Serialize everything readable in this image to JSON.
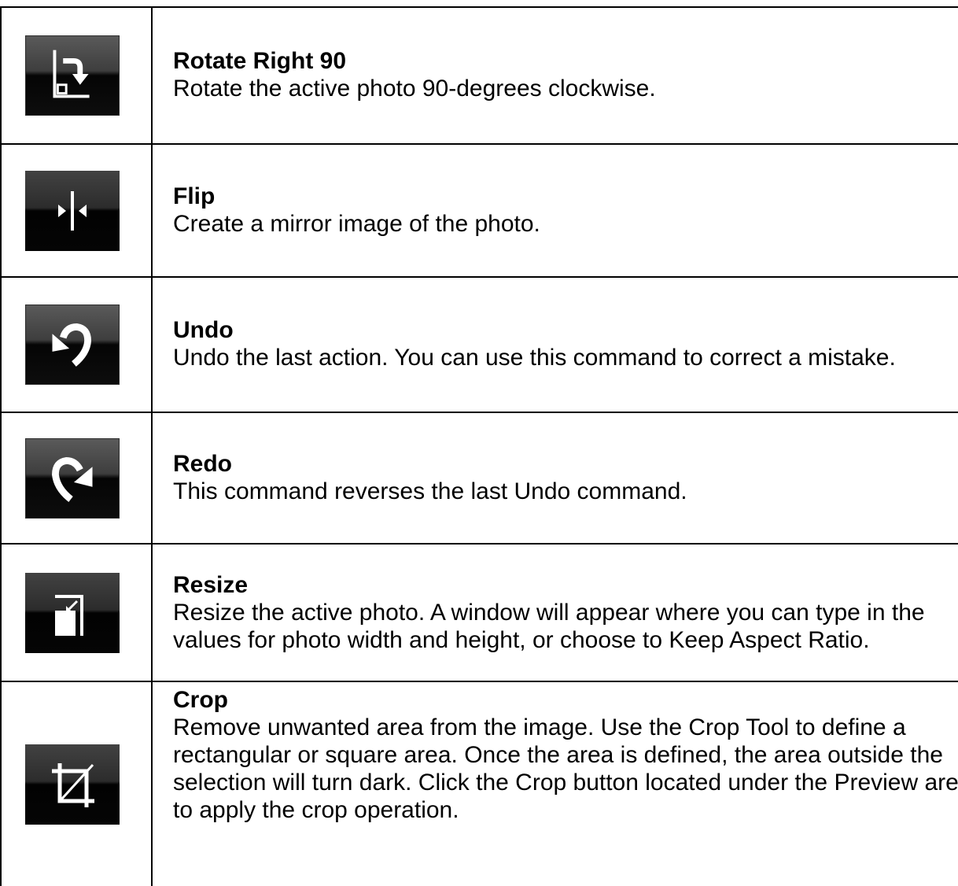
{
  "commands": [
    {
      "icon": "rotate-right-icon",
      "title": "Rotate Right 90",
      "description": "Rotate the active photo 90-degrees clockwise."
    },
    {
      "icon": "flip-icon",
      "title": "Flip",
      "description": "Create a mirror image of the photo."
    },
    {
      "icon": "undo-icon",
      "title": "Undo",
      "description": "Undo the last action. You can use this command to correct a mistake."
    },
    {
      "icon": "redo-icon",
      "title": "Redo",
      "description": "This command reverses the last Undo command."
    },
    {
      "icon": "resize-icon",
      "title": "Resize",
      "description": "Resize the active photo. A window will appear where you can type in the values for photo width and height, or choose to Keep Aspect Ratio."
    },
    {
      "icon": "crop-icon",
      "title": "Crop",
      "description": "Remove unwanted area from the image. Use the Crop Tool to define a rectangular or square area. Once the area is defined, the area outside the selection will turn dark. Click the Crop button located under the Preview area to apply the crop operation."
    }
  ],
  "colors": {
    "icon_button_top": "#5a5a5a",
    "icon_button_bottom": "#050505",
    "icon_glyph": "#ffffff",
    "border": "#000000"
  }
}
